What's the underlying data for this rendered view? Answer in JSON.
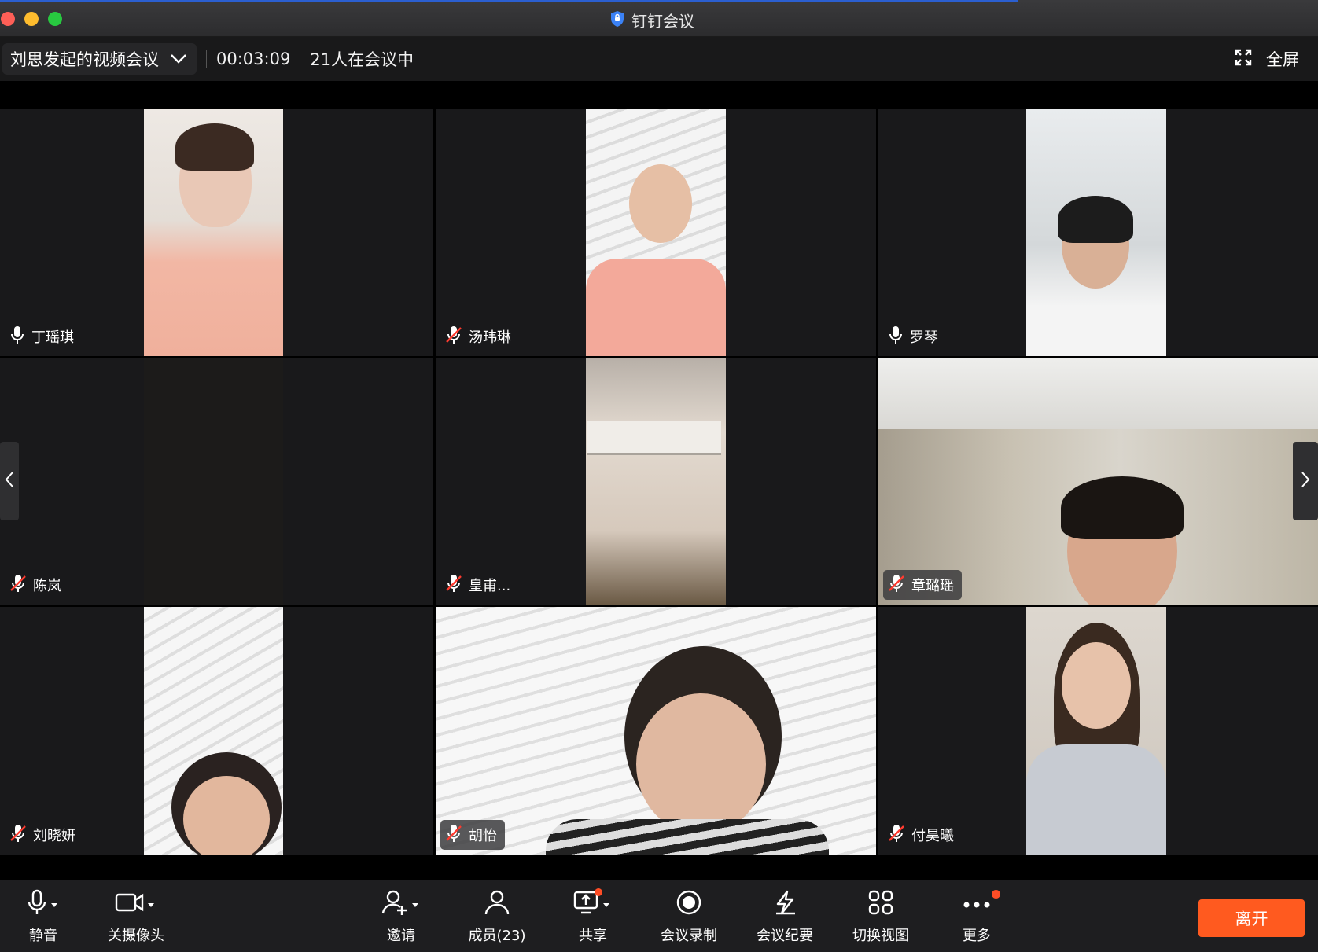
{
  "window": {
    "title": "钉钉会议"
  },
  "infobar": {
    "meeting_title": "刘思发起的视频会议",
    "timer": "00:03:09",
    "participants": "21人在会议中",
    "fullscreen_label": "全屏"
  },
  "tiles": [
    {
      "name": "丁瑶琪",
      "mic": "on"
    },
    {
      "name": "汤玮琳",
      "mic": "muted"
    },
    {
      "name": "罗琴",
      "mic": "on"
    },
    {
      "name": "陈岚",
      "mic": "muted"
    },
    {
      "name": "皇甫...",
      "mic": "muted"
    },
    {
      "name": "章璐瑶",
      "mic": "muted"
    },
    {
      "name": "刘晓妍",
      "mic": "muted"
    },
    {
      "name": "胡怡",
      "mic": "muted"
    },
    {
      "name": "付昊曦",
      "mic": "muted"
    }
  ],
  "toolbar": {
    "mute": "静音",
    "camera": "关摄像头",
    "invite": "邀请",
    "members": "成员(23)",
    "share": "共享",
    "record": "会议录制",
    "minutes": "会议纪要",
    "switch_view": "切换视图",
    "more": "更多",
    "leave": "离开"
  },
  "colors": {
    "accent_leave": "#ff5a1f",
    "badge": "#ff4d26",
    "tile_bg": "#19191b"
  }
}
